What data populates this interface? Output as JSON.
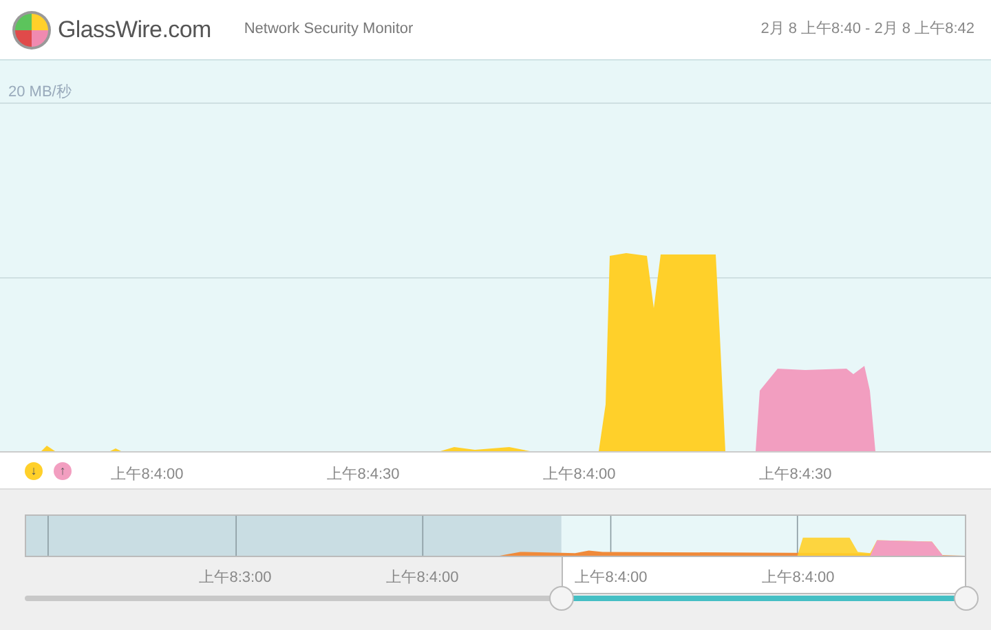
{
  "header": {
    "logo_text": "GlassWire.com",
    "subtitle": "Network Security Monitor",
    "time_range": "2月 8 上午8:40 - 2月 8 上午8:42"
  },
  "graph": {
    "y_label": "20 MB/秒",
    "legend": [
      {
        "symbol": "↓",
        "color": "#ffd02a"
      },
      {
        "symbol": "↑",
        "color": "#f29ec0"
      }
    ],
    "x_labels": [
      "上午8:4:00",
      "上午8:4:30",
      "上午8:4:00",
      "上午8:4:30"
    ]
  },
  "overview": {
    "x_labels": [
      "上午8:3:00",
      "上午8:4:00",
      "上午8:4:00",
      "上午8:4:00"
    ],
    "slider": {
      "level": 0.57
    }
  }
}
